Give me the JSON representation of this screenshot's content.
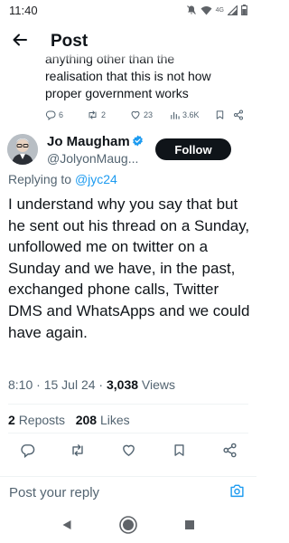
{
  "status_bar": {
    "time": "11:40",
    "network_label": "4G",
    "icons": [
      "mute-icon",
      "wifi-icon",
      "signal-icon",
      "battery-icon"
    ]
  },
  "header": {
    "title": "Post",
    "back_icon": "arrow-left-icon"
  },
  "parent_post": {
    "text_partial_line": "anything other than the",
    "text_lines": [
      "realisation that this is not how",
      "proper government works"
    ],
    "replies": "6",
    "reposts": "2",
    "likes": "23",
    "views": "3.6K"
  },
  "post": {
    "author_name": "Jo Maugham",
    "author_handle": "@JolyonMaug...",
    "follow_label": "Follow",
    "replying_prefix": "Replying to",
    "replying_handle": "@jyc24",
    "text": "I understand why you say that but he sent out his thread on a Sunday, unfollowed me on twitter on a Sunday and we have, in the past, exchanged phone calls, Twitter DMS and WhatsApps and we could have again.",
    "time": "8:10",
    "date": "15 Jul 24",
    "views_count": "3,038",
    "views_label": "Views",
    "reposts_count": "2",
    "reposts_label": "Reposts",
    "likes_count": "208",
    "likes_label": "Likes"
  },
  "reply_box": {
    "placeholder": "Post your reply"
  },
  "colors": {
    "accent": "#1d9bf0",
    "text_primary": "#0f1419",
    "text_secondary": "#536471",
    "divider": "#eff3f4"
  }
}
